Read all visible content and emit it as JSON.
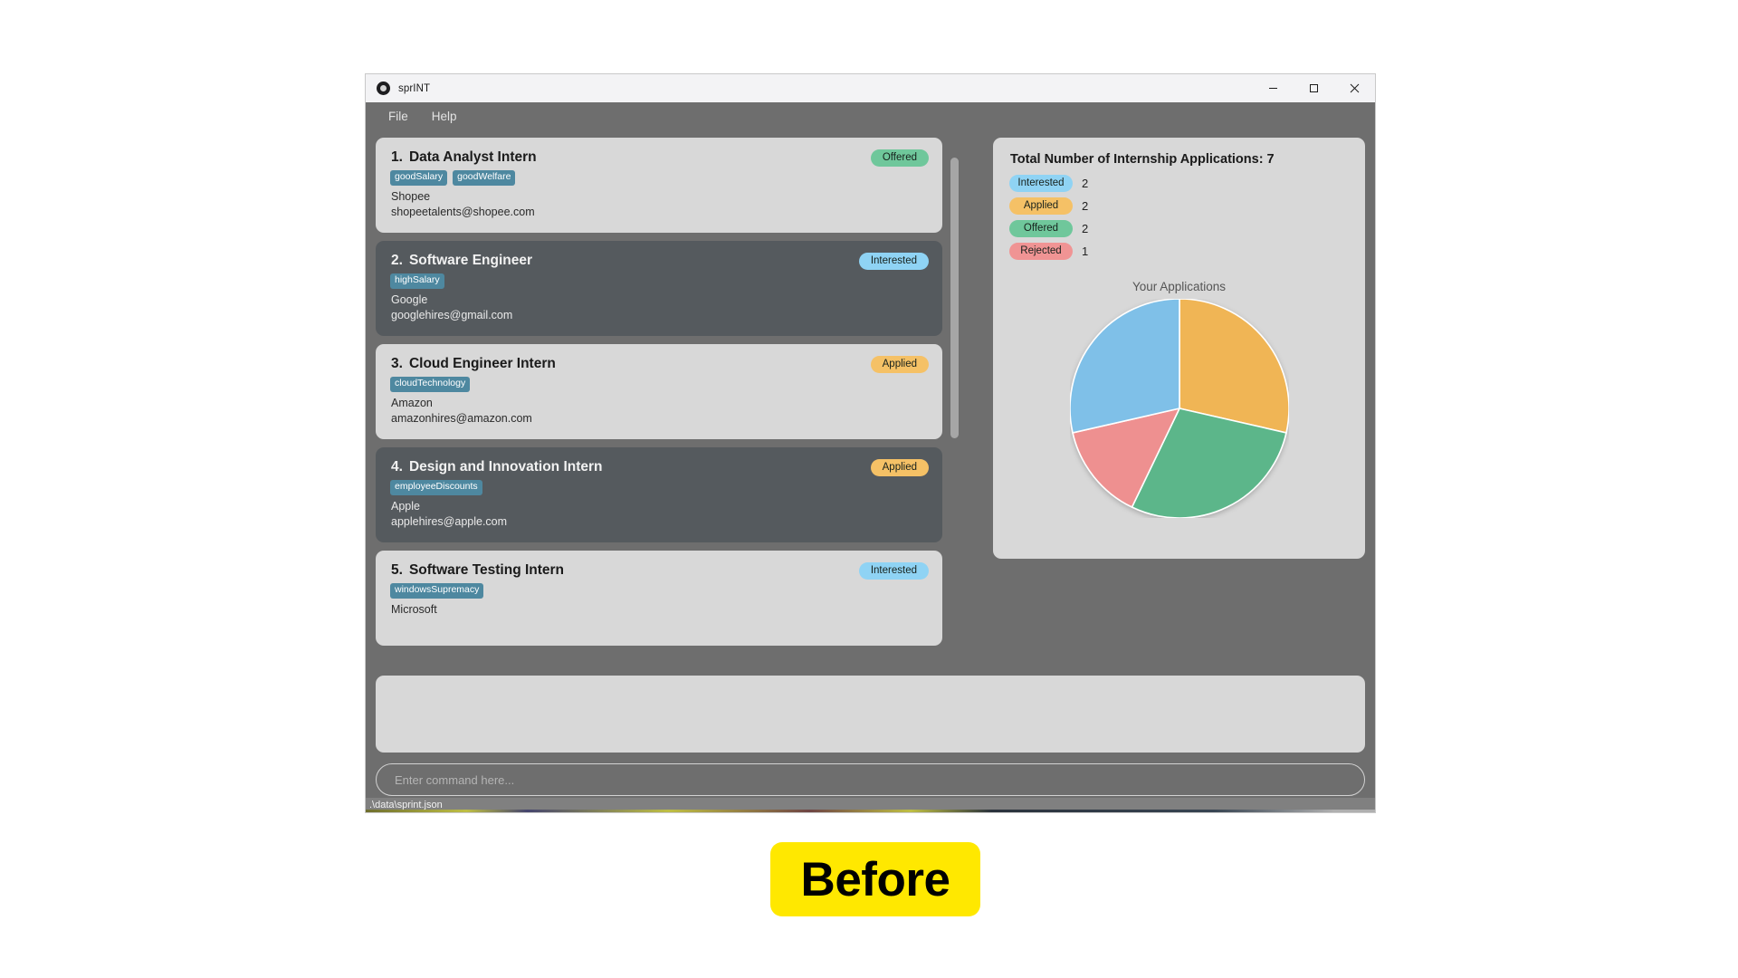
{
  "window": {
    "title": "sprINT",
    "icon": "app-logo-icon",
    "controls": {
      "minimize": "–",
      "maximize": "□",
      "close": "✕"
    }
  },
  "menu": {
    "items": [
      {
        "label": "File"
      },
      {
        "label": "Help"
      }
    ]
  },
  "applications": [
    {
      "index": "1.",
      "title": "Data Analyst Intern",
      "tags": [
        "goodSalary",
        "goodWelfare"
      ],
      "company": "Shopee",
      "email": "shopeetalents@shopee.com",
      "status": "Offered",
      "status_color": "#6fc79b",
      "theme": "light"
    },
    {
      "index": "2.",
      "title": "Software Engineer",
      "tags": [
        "highSalary"
      ],
      "company": "Google",
      "email": "googlehires@gmail.com",
      "status": "Interested",
      "status_color": "#8fd3f4",
      "theme": "dark"
    },
    {
      "index": "3.",
      "title": "Cloud Engineer Intern",
      "tags": [
        "cloudTechnology"
      ],
      "company": "Amazon",
      "email": "amazonhires@amazon.com",
      "status": "Applied",
      "status_color": "#f5c166",
      "theme": "light"
    },
    {
      "index": "4.",
      "title": "Design and Innovation Intern",
      "tags": [
        "employeeDiscounts"
      ],
      "company": "Apple",
      "email": "applehires@apple.com",
      "status": "Applied",
      "status_color": "#f5c166",
      "theme": "dark"
    },
    {
      "index": "5.",
      "title": "Software Testing Intern",
      "tags": [
        "windowsSupremacy"
      ],
      "company": "Microsoft",
      "email": "",
      "status": "Interested",
      "status_color": "#8fd3f4",
      "theme": "light"
    }
  ],
  "stats": {
    "title": "Total Number of Internship Applications: 7",
    "rows": [
      {
        "label": "Interested",
        "count": "2",
        "color": "#8fd3f4"
      },
      {
        "label": "Applied",
        "count": "2",
        "color": "#f5c166"
      },
      {
        "label": "Offered",
        "count": "2",
        "color": "#6fc79b"
      },
      {
        "label": "Rejected",
        "count": "1",
        "color": "#f09494"
      }
    ]
  },
  "chart_data": {
    "type": "pie",
    "title": "Your Applications",
    "categories": [
      "Applied",
      "Offered",
      "Rejected",
      "Interested"
    ],
    "values": [
      2,
      2,
      1,
      2
    ],
    "colors": [
      "#f0b555",
      "#5cb68a",
      "#ee9090",
      "#7fc0e8"
    ],
    "total": 7,
    "start_angle_deg": 0,
    "direction": "clockwise",
    "legend": "none",
    "slice_border": "#ffffff"
  },
  "console": {
    "output_text": "",
    "input_value": "",
    "input_placeholder": "Enter command here..."
  },
  "status_bar": {
    "path": ".\\data\\sprint.json"
  },
  "overlay": {
    "badge_label": "Before"
  }
}
